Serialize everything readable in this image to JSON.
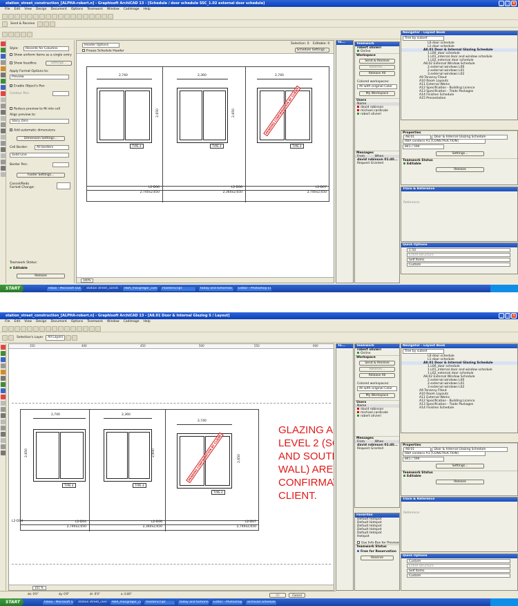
{
  "menu": [
    "File",
    "Edit",
    "View",
    "Design",
    "Document",
    "Options",
    "Teamwork",
    "Window",
    "Cadimage",
    "Help"
  ],
  "taskbar": {
    "start_label": "START",
    "tasks": [
      "Inbox - Microsoft Out...",
      "station street_constr...",
      "RBA_macgregor_constr...",
      "masterscript",
      "today and tomorrow ...",
      "Editor - Photoshop El..."
    ],
    "tasks2": [
      "Inbox - Microsoft Out...",
      "station street_constr...",
      "RBA_macgregor_constr...",
      "masterscript",
      "today and tomorrow ...",
      "Editor - Photoshop El...",
      "archicad schedule so..."
    ]
  },
  "shot1": {
    "title": "station_street_construction_[ALPHA-robert.n] - Graphisoft ArchiCAD 13 - [Schedule / door schedule SSC_1.02 external door schedule]",
    "toolbar": {
      "send_receive": "Send & Receive"
    },
    "info": {
      "style_label": "Style:",
      "style_value": "Records for Columns",
      "show_uniform": "Show uniform items as a single entry",
      "show_headline": "Show headline",
      "settings": "Settings...",
      "apply_format": "Apply Format Options to:",
      "apply_value": "Preview",
      "enable_pen": "Enable Object's Pen",
      "contour_pen": "Contour Pen:",
      "reduce": "Reduce preview to fit into cell",
      "align": "Align preview to:",
      "align_value": "Story Zero",
      "add_dims": "Add automatic dimensions",
      "dim_settings": "Dimension Settings...",
      "cell_border": "Cell Border:",
      "cell_border_value": "All borders",
      "line_value": "Solid Line",
      "border_pen": "Border Pen:",
      "footer_settings": "Footer Settings...",
      "cancel_redo": "Cancel/Redo",
      "format_change": "Format Change:",
      "teamwork_status": "Teamwork Status:",
      "editable": "Editable",
      "release": "Release"
    },
    "schedule": {
      "header_options": "Header Options",
      "freeze": "Freeze Schedule Header",
      "selection_label": "Selection:",
      "selection_value": "0",
      "editable_label": "Editable:",
      "editable_value": "0",
      "schedule_settings": "Schedule Settings...",
      "zoom": "100%",
      "doors": [
        {
          "width": "2,740",
          "height": "2,650",
          "id": "L2-D06",
          "size": "2,740x2,650",
          "type": "TYPE 4",
          "stamp": ""
        },
        {
          "width": "2,360",
          "height": "2,650",
          "id": "L2-D06",
          "size": "2,360x2,650",
          "type": "TYPE 4",
          "stamp": ""
        },
        {
          "width": "2,740",
          "height": "2,650",
          "id": "L2-D07",
          "size": "2,740x2,650",
          "type": "TYPE 4",
          "stamp": "PENDING CONFIRMATION BY CLIENT"
        }
      ]
    }
  },
  "shot2": {
    "title": "station_street_construction_[ALPHA-robert.n] - Graphisoft ArchiCAD 13 - [A8.01 Door & Internal Glazing S / Layout]",
    "toolbar": {
      "selection_layer": "Selection's Layer",
      "layers": "All Layers"
    },
    "ruler": [
      "350",
      "400",
      "450",
      "500",
      "550",
      "600"
    ],
    "doors": [
      {
        "width": "2,740",
        "height": "2,650",
        "id": "L2-D04",
        "size": "2,740x2,650",
        "type": "TYPE 4",
        "stamp": ""
      },
      {
        "width": "2,360",
        "height": "2,650",
        "id": "L2-D06",
        "size": "2,360x2,650",
        "type": "TYPE 4",
        "stamp": ""
      },
      {
        "width": "2,740",
        "height": "2,650",
        "id": "L2-D07",
        "size": "2,740x2,650",
        "type": "TYPE 4",
        "stamp": "PENDING CONFIRMATION BY CLIENT"
      }
    ],
    "partial_label": "L2-D04",
    "red_note": "GLAZING AS\nLEVEL 2 (SC\nAND SOUTH\nWALL) ARE I\nCONFIRMAT\nCLIENT.",
    "zoom": "101 %",
    "status": [
      "dx: 0'0\"",
      "dy: 0'0\"",
      "dr: 0'0\"",
      "a: 0.00°"
    ],
    "cancel_btn": "Cancel",
    "ok_btn": "OK"
  },
  "teamwork": {
    "title": "Teamwork",
    "user": "robert olivieri",
    "online": "Online",
    "workspace": "Workspace",
    "send_receive": "Send & Receive",
    "reserve": "Reserve...",
    "release_all": "Release All",
    "colored_label": "Colored workspaces:",
    "colored_value": "All with original Color",
    "my_workspace": "My Workspace",
    "users_label": "Users",
    "name_col": "Name",
    "users": [
      {
        "name": "david robinson",
        "color": "#c71414"
      },
      {
        "name": "michael cardinale",
        "color": "#c71414"
      },
      {
        "name": "robert olivieri",
        "color": "#2a9a2a"
      }
    ],
    "messages": "Messages",
    "from_col": "From",
    "when_col": "When",
    "msg_from": "david robinson",
    "msg_text": "Request Granted",
    "msg_time": "01:40..."
  },
  "favorites": {
    "title": "Favorites",
    "items": [
      "Default Hotspot",
      "Default Hotspot",
      "Default Hotspot",
      "Default Hotspot",
      "Default Hotspot",
      "Hotspot"
    ],
    "use_info": "Use Info Box for Preview",
    "status": "Teamwork Status",
    "free": "Free for Reservation",
    "reserve": "Reserve"
  },
  "navigator": {
    "title": "Navigator - Layout Book",
    "tree_by": "Tree by subset",
    "items": [
      {
        "label": "L0-door schedule",
        "indent": 2,
        "sel": false
      },
      {
        "label": "L1-door schedule",
        "indent": 2,
        "sel": false
      },
      {
        "label": "A8.01 Door & Internal Glazing Schedule",
        "indent": 1,
        "sel": true
      },
      {
        "label": "1.L00_door schedule",
        "indent": 2,
        "sel": false
      },
      {
        "label": "1.L01_internal door and window schedule",
        "indent": 2,
        "sel": false
      },
      {
        "label": "1.L02_external door schedule",
        "indent": 2,
        "sel": false
      },
      {
        "label": "A8.02 External Window Schedule",
        "indent": 1,
        "sel": false
      },
      {
        "label": "2.external windows L00",
        "indent": 2,
        "sel": false
      },
      {
        "label": "2.external windows L01",
        "indent": 2,
        "sel": false
      },
      {
        "label": "3.external windows L02",
        "indent": 2,
        "sel": false
      },
      {
        "label": "A9 Tenancy Fitout",
        "indent": 0,
        "sel": false
      },
      {
        "label": "A10 Room Layouts",
        "indent": 0,
        "sel": false
      },
      {
        "label": "A11 External Works",
        "indent": 0,
        "sel": false
      },
      {
        "label": "A12 Specification - Building Licence",
        "indent": 0,
        "sel": false
      },
      {
        "label": "A13 Specification - Trade Packages",
        "indent": 0,
        "sel": false
      },
      {
        "label": "A14 Finishes Schedule",
        "indent": 0,
        "sel": false
      },
      {
        "label": "A15 Presentation",
        "indent": 0,
        "sel": false
      }
    ],
    "properties": "Properties",
    "prop_id": "A8.01",
    "prop_name": "Door & Internal Glazing Schedule",
    "prop_master": "RBA condocs A1 [CONSTRUCTION]",
    "prop_scale": "841 / 594",
    "settings": "Settings...",
    "tw_status": "Teamwork Status",
    "editable": "Editable",
    "release": "Release"
  },
  "trace": {
    "title": "Trace & Reference",
    "reference": "Reference:"
  },
  "quick": {
    "title": "Quick Options",
    "items": [
      "1:50",
      "Entire Structure",
      "Self Items",
      "Custom",
      "Custom"
    ]
  }
}
